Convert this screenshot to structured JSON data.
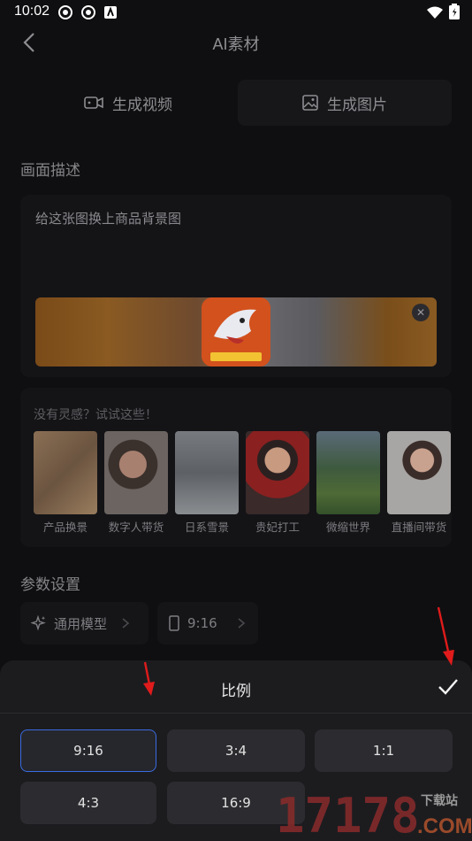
{
  "status_bar": {
    "time": "10:02"
  },
  "header": {
    "title": "AI素材"
  },
  "tabs": [
    {
      "label": "生成视频",
      "icon": "video-camera-icon"
    },
    {
      "label": "生成图片",
      "icon": "image-icon"
    }
  ],
  "description": {
    "section_title": "画面描述",
    "text": "给这张图换上商品背景图"
  },
  "inspiration": {
    "title": "没有灵感？试试这些！",
    "items": [
      {
        "label": "产品换景"
      },
      {
        "label": "数字人带货"
      },
      {
        "label": "日系雪景"
      },
      {
        "label": "贵妃打工"
      },
      {
        "label": "微缩世界"
      },
      {
        "label": "直播间带货"
      }
    ]
  },
  "params": {
    "section_title": "参数设置",
    "model_label": "通用模型",
    "ratio_label": "9:16"
  },
  "sheet": {
    "title": "比例",
    "options": [
      {
        "label": "9:16",
        "selected": true
      },
      {
        "label": "3:4",
        "selected": false
      },
      {
        "label": "1:1",
        "selected": false
      },
      {
        "label": "4:3",
        "selected": false
      },
      {
        "label": "16:9",
        "selected": false
      }
    ]
  },
  "watermark": {
    "number": "17178",
    "site": "下载站",
    "domain": ".COM"
  },
  "colors": {
    "accent": "#3a6be0",
    "annotation": "#e01b1b",
    "background": "#0f0f11"
  }
}
